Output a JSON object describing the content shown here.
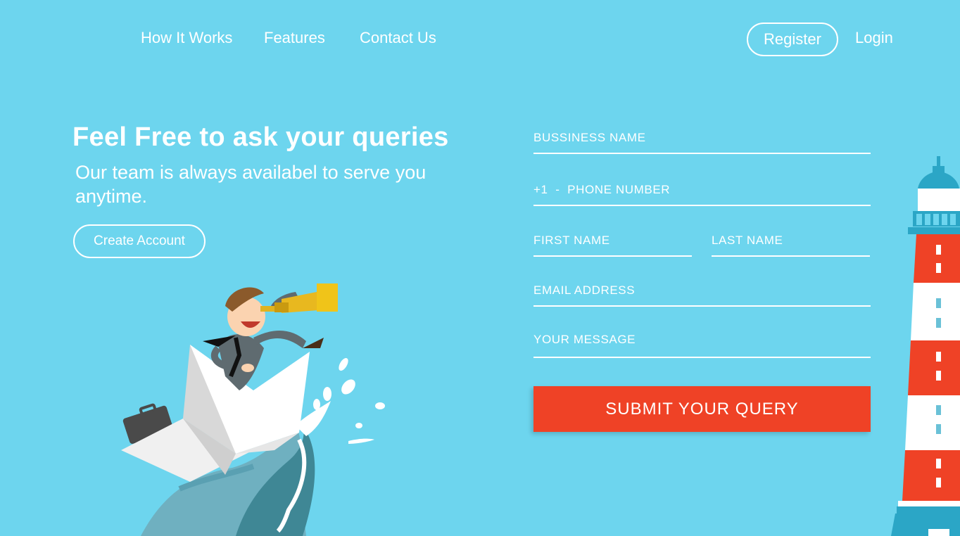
{
  "nav": {
    "links": [
      "How It Works",
      "Features",
      "Contact Us"
    ],
    "register": "Register",
    "login": "Login"
  },
  "hero": {
    "title": "Feel Free to ask your queries",
    "subtitle": "Our team is always availabel to serve you anytime.",
    "create_account": "Create Account"
  },
  "form": {
    "business_name": "BUSSINESS NAME",
    "phone": "+1  -  PHONE NUMBER",
    "first_name": "FIRST NAME",
    "last_name": "LAST NAME",
    "email": "EMAIL ADDRESS",
    "message": "YOUR MESSAGE",
    "submit": "SUBMIT YOUR QUERY"
  },
  "colors": {
    "background": "#6dd5ee",
    "accent": "#ef4226",
    "text": "#ffffff"
  },
  "icons": [
    "businessman-telescope-illustration",
    "paper-boat-icon",
    "wave-icon",
    "lighthouse-icon"
  ]
}
